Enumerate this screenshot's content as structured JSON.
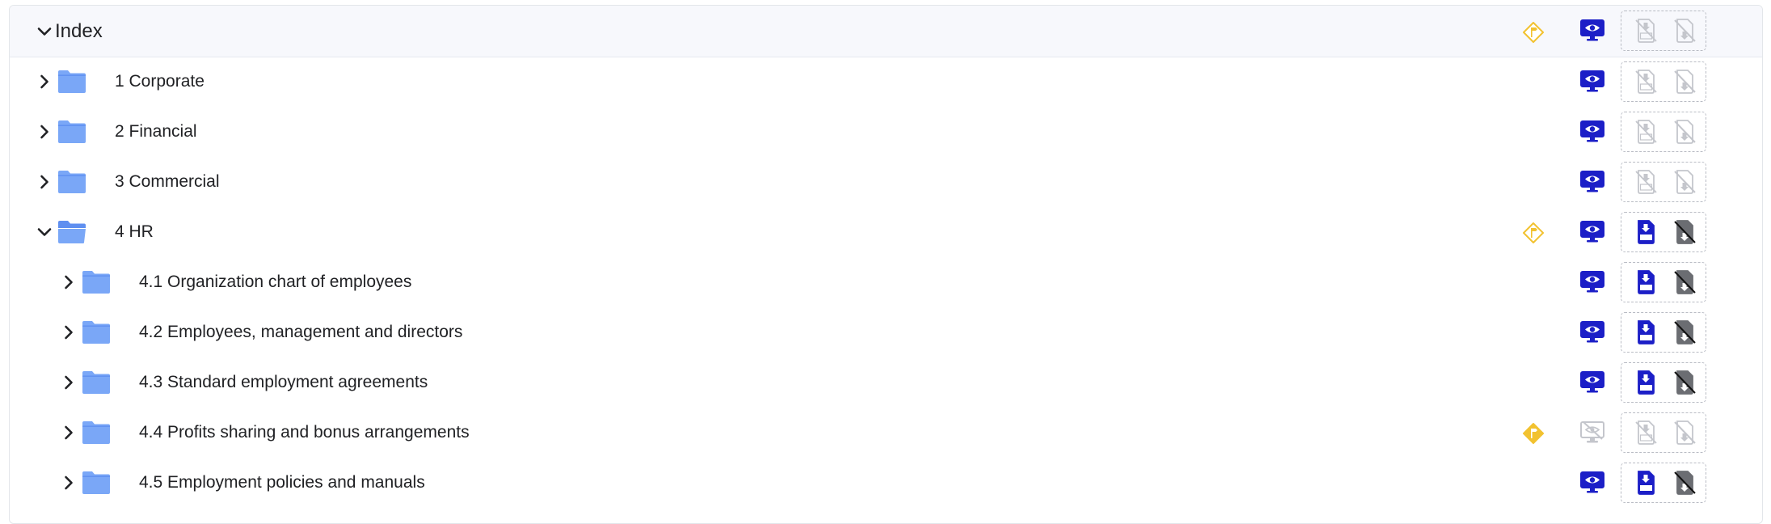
{
  "index": {
    "title": "Index",
    "expanded": true,
    "has_tag": true,
    "pdf_enabled": false
  },
  "rows": [
    {
      "label": "1 Corporate",
      "level": 1,
      "expanded": false,
      "tag": null,
      "view_enabled": true,
      "pdf_enabled": false
    },
    {
      "label": "2 Financial",
      "level": 1,
      "expanded": false,
      "tag": null,
      "view_enabled": true,
      "pdf_enabled": false
    },
    {
      "label": "3 Commercial",
      "level": 1,
      "expanded": false,
      "tag": null,
      "view_enabled": true,
      "pdf_enabled": false
    },
    {
      "label": "4 HR",
      "level": 1,
      "expanded": true,
      "tag": "outline",
      "view_enabled": true,
      "pdf_enabled": true
    },
    {
      "label": "4.1 Organization chart of employees",
      "level": 2,
      "expanded": false,
      "tag": null,
      "view_enabled": true,
      "pdf_enabled": true
    },
    {
      "label": "4.2 Employees, management and directors",
      "level": 2,
      "expanded": false,
      "tag": null,
      "view_enabled": true,
      "pdf_enabled": true
    },
    {
      "label": "4.3 Standard employment agreements",
      "level": 2,
      "expanded": false,
      "tag": null,
      "view_enabled": true,
      "pdf_enabled": true
    },
    {
      "label": "4.4 Profits sharing and bonus arrangements",
      "level": 2,
      "expanded": false,
      "tag": "filled",
      "view_enabled": false,
      "pdf_enabled": false
    },
    {
      "label": "4.5 Employment policies and manuals",
      "level": 2,
      "expanded": false,
      "tag": null,
      "view_enabled": true,
      "pdf_enabled": true
    }
  ],
  "icons": {
    "chevron_down": "chevron-down-icon",
    "chevron_right": "chevron-right-icon",
    "folder": "folder-icon",
    "folder_open": "folder-open-icon",
    "tag": "tag-icon",
    "view": "monitor-eye-icon",
    "pdf": "pdf-download-icon",
    "no_print": "print-disabled-icon"
  },
  "colors": {
    "accent_blue": "#1c1fc7",
    "folder_blue": "#7aa7f7",
    "folder_blue_dark": "#5f8ff0",
    "tag_yellow": "#f2c230",
    "disabled_gray": "#c4c6cc",
    "noprint_gray": "#6b6d72"
  }
}
